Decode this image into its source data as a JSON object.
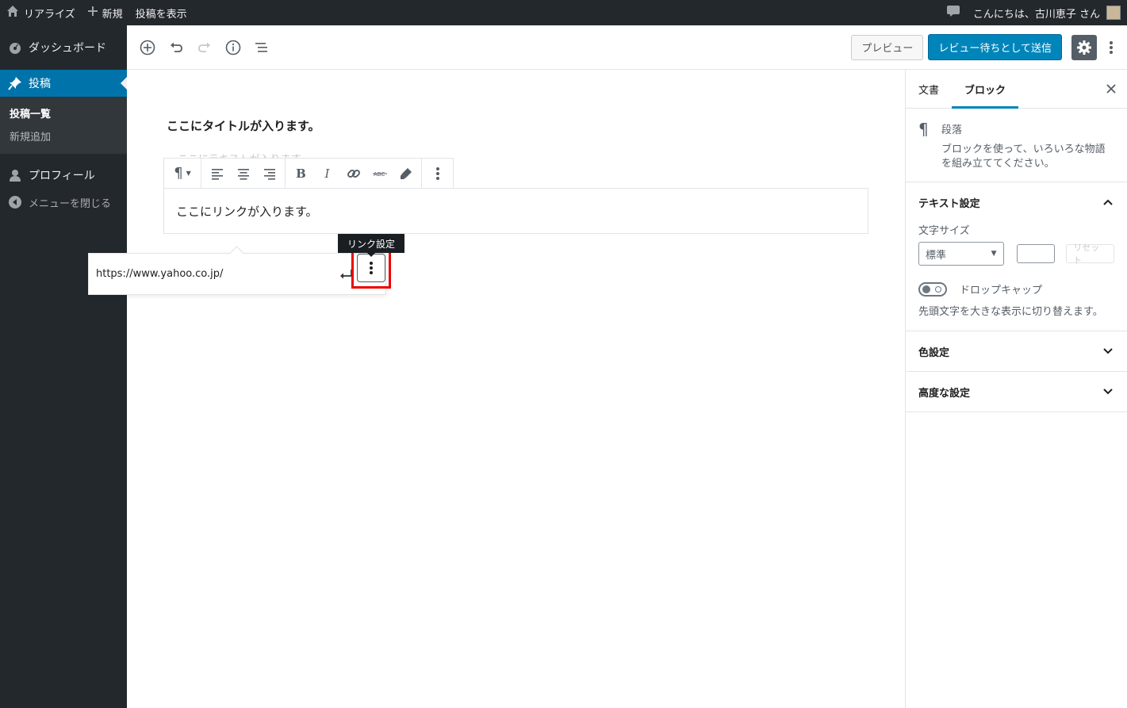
{
  "admin_bar": {
    "site_name": "リアライズ",
    "new_label": "新規",
    "view_post": "投稿を表示",
    "greeting": "こんにちは、古川恵子 さん"
  },
  "admin_menu": {
    "dashboard": "ダッシュボード",
    "posts": "投稿",
    "posts_list": "投稿一覧",
    "add_new": "新規追加",
    "profile": "プロフィール",
    "collapse": "メニューを閉じる"
  },
  "header": {
    "preview": "プレビュー",
    "submit_review": "レビュー待ちとして送信"
  },
  "editor": {
    "post_title": "ここにタイトルが入ります。",
    "ghost_text": "ここにテキストが入ります。",
    "paragraph_text": "ここにリンクが入ります。",
    "link_url": "https://www.yahoo.co.jp/",
    "tooltip": "リンク設定"
  },
  "sidebar": {
    "tab_document": "文書",
    "tab_block": "ブロック",
    "block_name": "段落",
    "block_desc": "ブロックを使って、いろいろな物語を組み立ててください。",
    "text_settings": "テキスト設定",
    "font_size_label": "文字サイズ",
    "font_size_value": "標準",
    "reset": "リセット",
    "drop_cap": "ドロップキャップ",
    "drop_cap_help": "先頭文字を大きな表示に切り替えます。",
    "color_settings": "色設定",
    "advanced": "高度な設定"
  },
  "colors": {
    "admin_bg": "#23282d",
    "accent": "#0085ba",
    "highlight": "#ee0000"
  }
}
